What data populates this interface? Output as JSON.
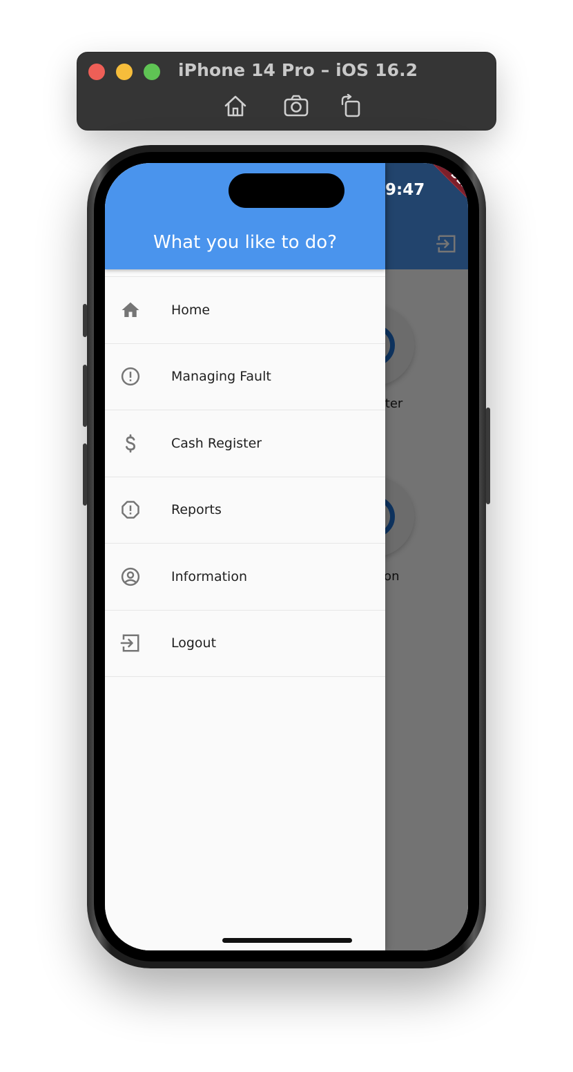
{
  "window": {
    "title": "iPhone 14 Pro – iOS 16.2",
    "toolbar_icons": [
      "home-icon",
      "screenshot-icon",
      "rotate-icon"
    ]
  },
  "status_bar": {
    "time": "9:47"
  },
  "debug_banner": "DEBUG",
  "drawer": {
    "title": "What you like to do?",
    "items": [
      {
        "label": "Home",
        "icon": "home-icon"
      },
      {
        "label": "Managing Fault",
        "icon": "error-outline-icon"
      },
      {
        "label": "Cash Register",
        "icon": "dollar-icon"
      },
      {
        "label": "Reports",
        "icon": "report-icon"
      },
      {
        "label": "Information",
        "icon": "account-circle-icon"
      },
      {
        "label": "Logout",
        "icon": "logout-icon"
      }
    ]
  },
  "background_page": {
    "partial_labels": [
      "gister",
      "tion"
    ]
  },
  "colors": {
    "app_bar": "#4a94ed",
    "drawer_background": "#fafafa",
    "debug_banner": "#7d1f2a",
    "icon_gray": "#757575"
  }
}
